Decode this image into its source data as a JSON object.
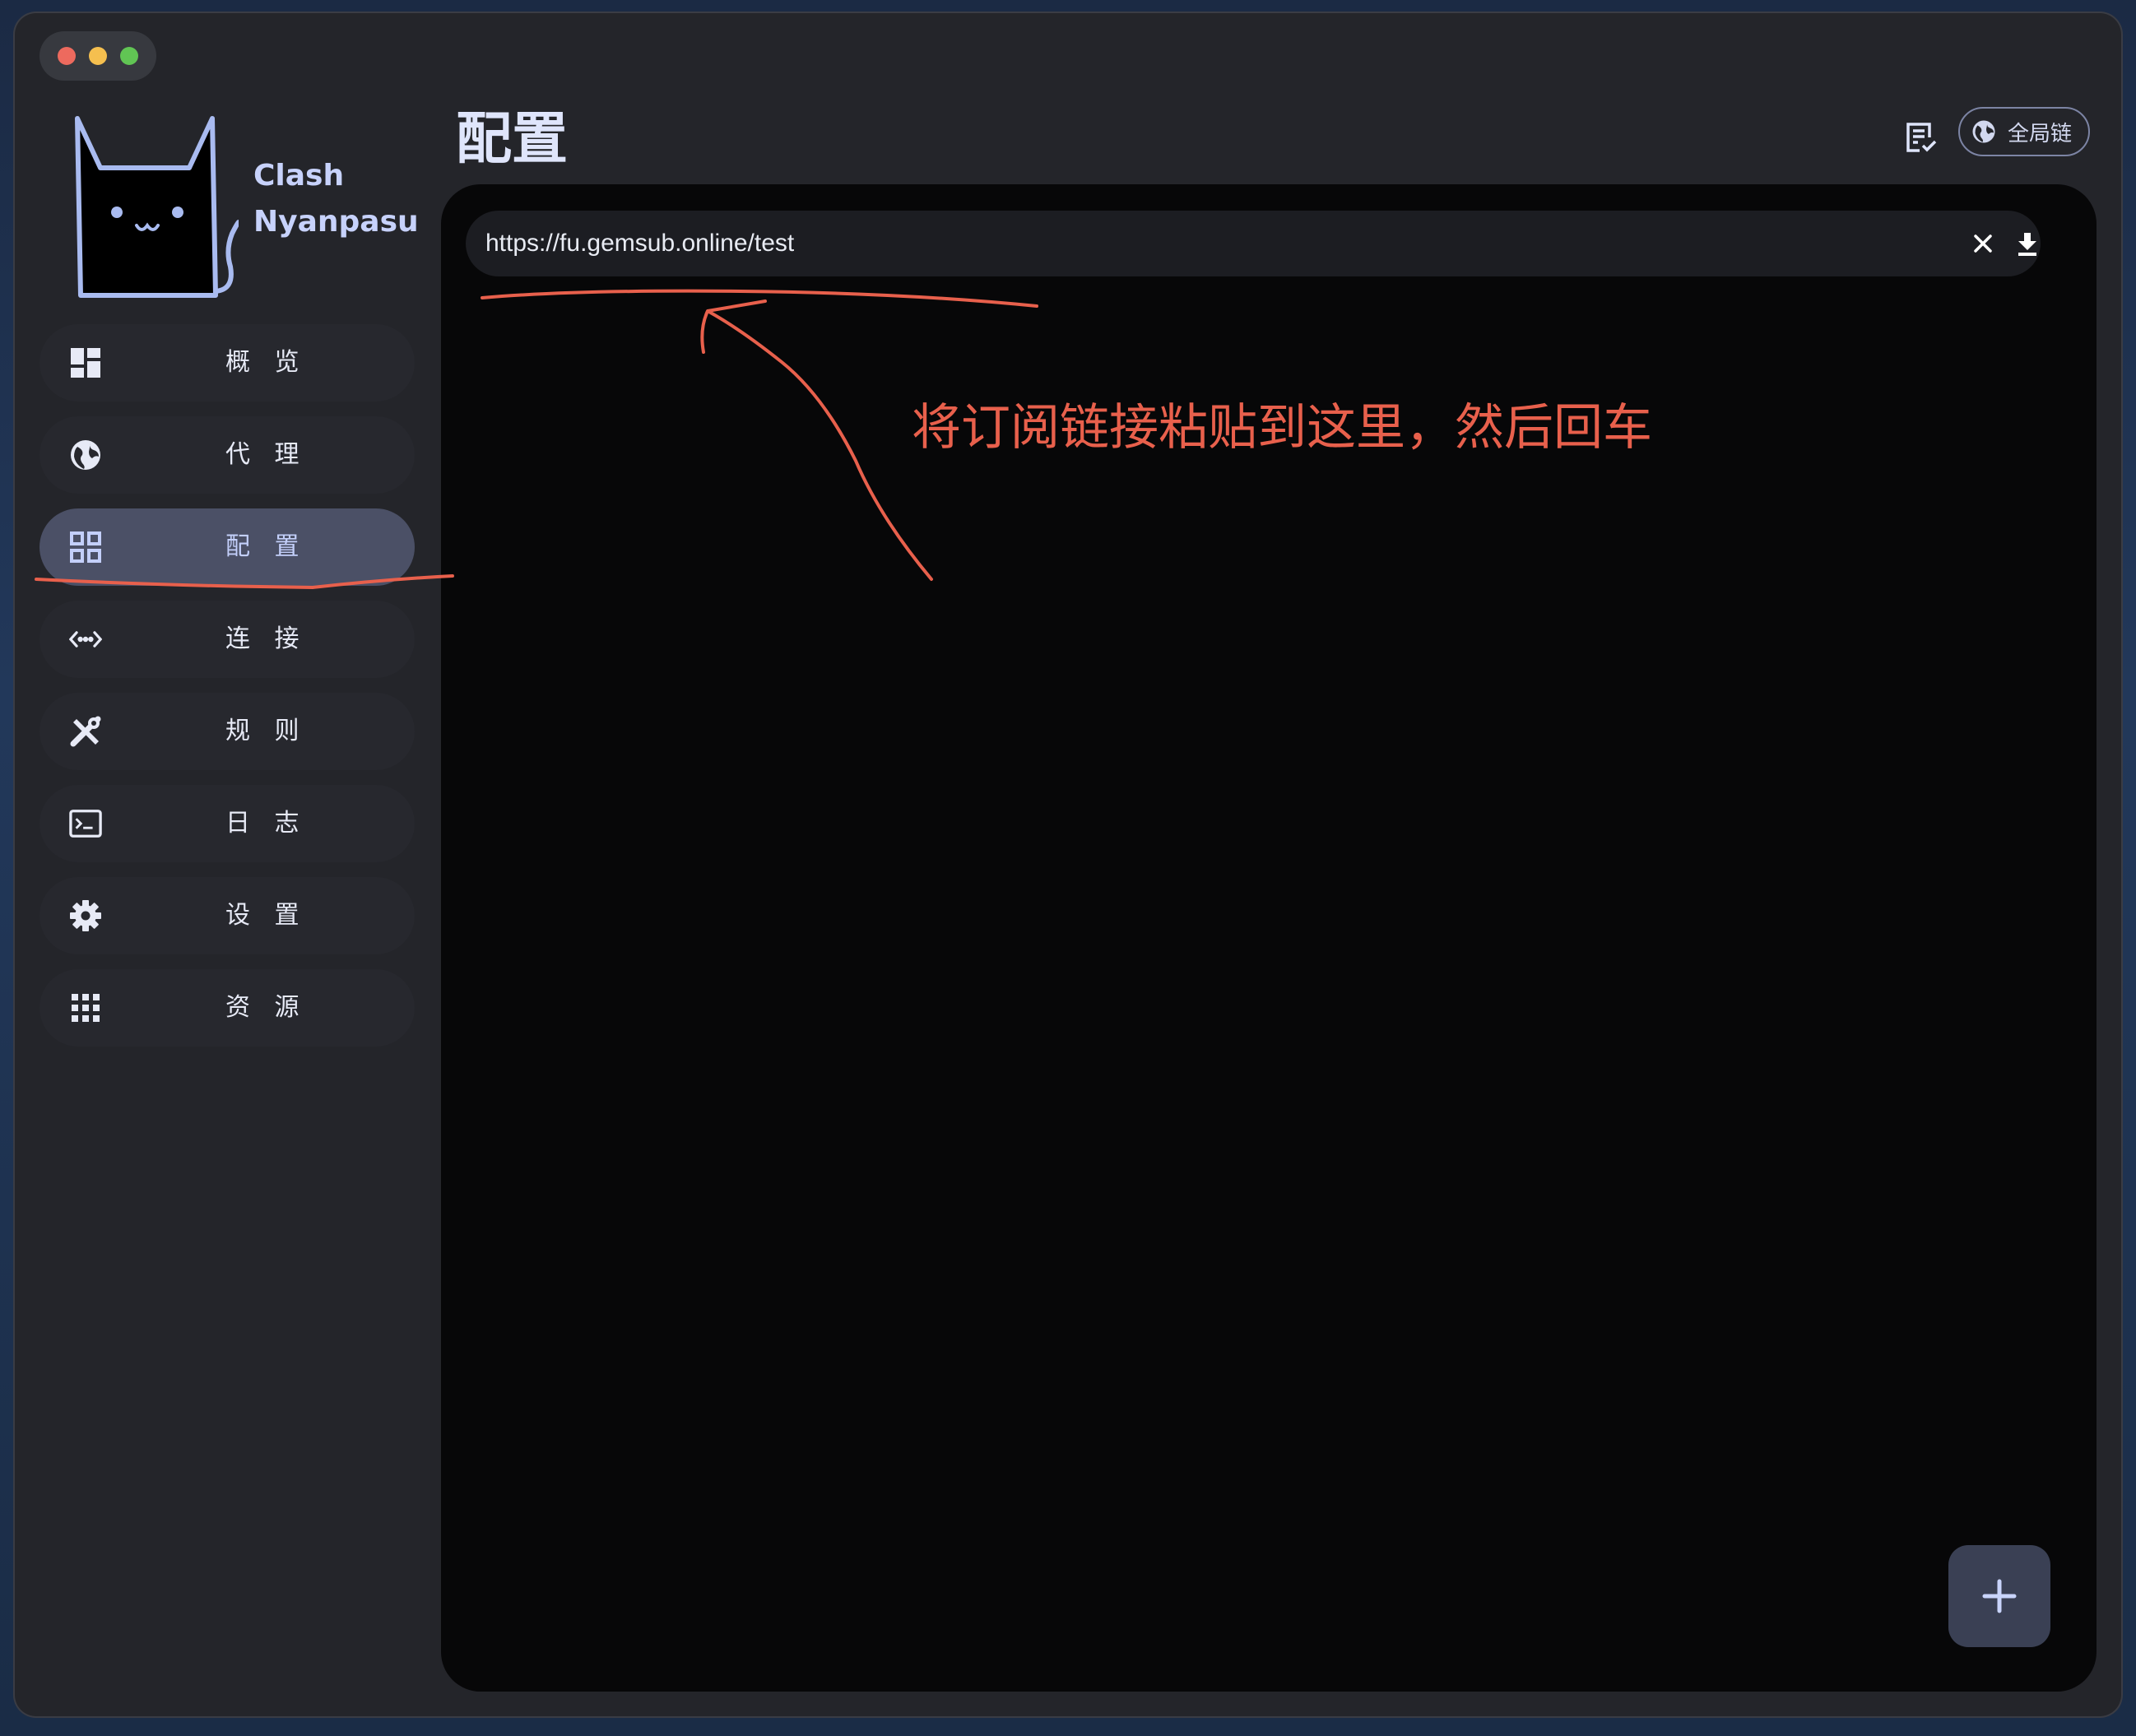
{
  "app": {
    "name_line1": "Clash",
    "name_line2": "Nyanpasu"
  },
  "sidebar": {
    "items": [
      {
        "label": "概 览",
        "icon": "dashboard-icon"
      },
      {
        "label": "代 理",
        "icon": "globe-icon"
      },
      {
        "label": "配 置",
        "icon": "grid-icon",
        "active": true
      },
      {
        "label": "连 接",
        "icon": "code-dots-icon"
      },
      {
        "label": "规 则",
        "icon": "tools-icon"
      },
      {
        "label": "日 志",
        "icon": "terminal-icon"
      },
      {
        "label": "设 置",
        "icon": "gear-icon"
      },
      {
        "label": "资 源",
        "icon": "apps-grid-icon"
      }
    ]
  },
  "header": {
    "title": "配置",
    "mode_chip": "全局链"
  },
  "subscription": {
    "url_value": "https://fu.gemsub.online/test"
  },
  "annotation": {
    "text": "将订阅链接粘贴到这里，然后回车"
  },
  "colors": {
    "accent": "#c3cffa",
    "active_nav_bg": "#4b5066",
    "annotation": "#e8604c"
  }
}
